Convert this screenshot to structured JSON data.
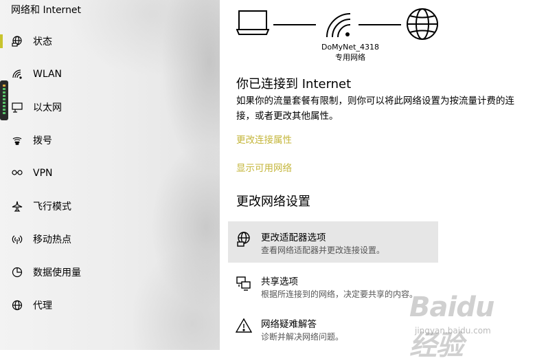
{
  "sidebar": {
    "title": "网络和 Internet",
    "accent_color": "#c8c42e",
    "items": [
      {
        "label": "状态",
        "icon": "status-globe-icon",
        "selected": true
      },
      {
        "label": "WLAN",
        "icon": "wifi-icon"
      },
      {
        "label": "以太网",
        "icon": "ethernet-icon"
      },
      {
        "label": "拨号",
        "icon": "dialup-icon"
      },
      {
        "label": "VPN",
        "icon": "vpn-icon"
      },
      {
        "label": "飞行模式",
        "icon": "airplane-icon"
      },
      {
        "label": "移动热点",
        "icon": "hotspot-icon"
      },
      {
        "label": "数据使用量",
        "icon": "data-usage-icon"
      },
      {
        "label": "代理",
        "icon": "proxy-globe-icon"
      }
    ]
  },
  "main": {
    "network": {
      "name": "DoMyNet_4318",
      "type": "专用网络"
    },
    "connected_heading": "你已连接到 Internet",
    "connected_desc": "如果你的流量套餐有限制，则你可以将此网络设置为按流量计费的连接，或者更改其他属性。",
    "link_color": "#c4b63b",
    "links": {
      "change_props": "更改连接属性",
      "show_networks": "显示可用网络"
    },
    "section_heading": "更改网络设置",
    "options": [
      {
        "title": "更改适配器选项",
        "subtitle": "查看网络适配器并更改连接设置。",
        "icon": "adapter-icon"
      },
      {
        "title": "共享选项",
        "subtitle": "根据所连接到的网络，决定要共享的内容。",
        "icon": "sharing-icon"
      },
      {
        "title": "网络疑难解答",
        "subtitle": "诊断并解决网络问题。",
        "icon": "warning-icon"
      }
    ]
  },
  "watermark": {
    "brand": "Baidu 经验",
    "url": "jingyan.baidu.com"
  }
}
